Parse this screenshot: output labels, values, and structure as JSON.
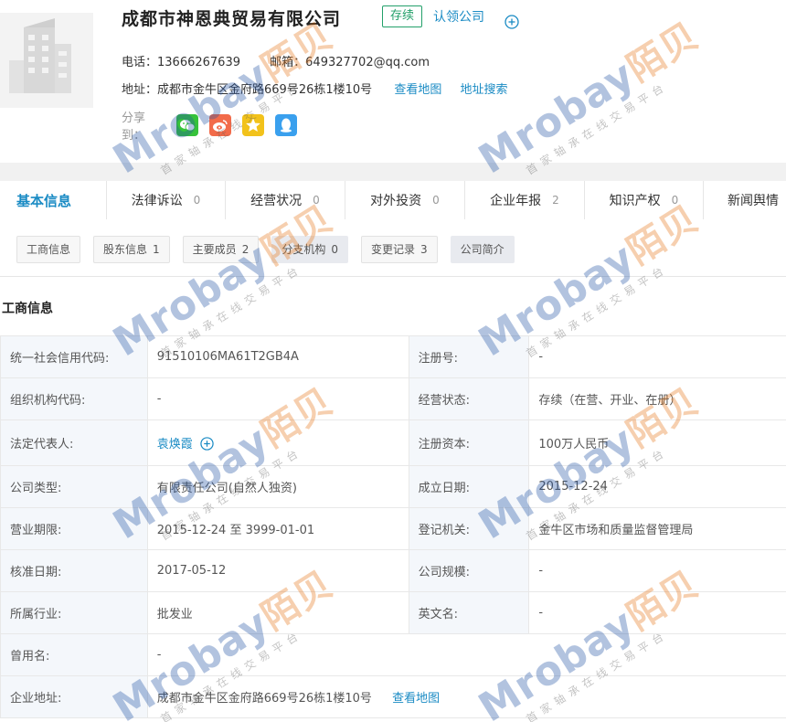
{
  "company": {
    "name": "成都市神恩典贸易有限公司",
    "status": "存续",
    "claim_label": "认领公司",
    "phone_label": "电话：",
    "phone": "13666267639",
    "email_label": "邮箱：",
    "email": "649327702@qq.com",
    "address_label": "地址：",
    "address": "成都市金牛区金府路669号26栋1楼10号",
    "view_map": "查看地图",
    "address_search": "地址搜索",
    "share_label": "分享到："
  },
  "colors": {
    "link": "#1a8bc4",
    "status": "#23a06a"
  },
  "share_icons": [
    "wechat-icon",
    "weibo-icon",
    "star-icon",
    "qq-icon"
  ],
  "main_tabs": [
    {
      "label": "基本信息",
      "count": ""
    },
    {
      "label": "法律诉讼",
      "count": "0"
    },
    {
      "label": "经营状况",
      "count": "0"
    },
    {
      "label": "对外投资",
      "count": "0"
    },
    {
      "label": "企业年报",
      "count": "2"
    },
    {
      "label": "知识产权",
      "count": "0"
    },
    {
      "label": "新闻舆情",
      "count": ""
    }
  ],
  "sub_tabs": [
    {
      "label": "工商信息",
      "count": ""
    },
    {
      "label": "股东信息",
      "count": "1"
    },
    {
      "label": "主要成员",
      "count": "2"
    },
    {
      "label": "分支机构",
      "count": "0"
    },
    {
      "label": "变更记录",
      "count": "3"
    },
    {
      "label": "公司简介",
      "count": ""
    }
  ],
  "section_title": "工商信息",
  "rows": [
    {
      "k1": "统一社会信用代码:",
      "v1": "91510106MA61T2GB4A",
      "k2": "注册号:",
      "v2": "-"
    },
    {
      "k1": "组织机构代码:",
      "v1": "-",
      "k2": "经营状态:",
      "v2": "存续（在营、开业、在册）"
    },
    {
      "k1": "法定代表人:",
      "v1": "袁焕霞",
      "k2": "注册资本:",
      "v2": "100万人民币"
    },
    {
      "k1": "公司类型:",
      "v1": "有限责任公司(自然人独资)",
      "k2": "成立日期:",
      "v2": "2015-12-24"
    },
    {
      "k1": "营业期限:",
      "v1": "2015-12-24 至 3999-01-01",
      "k2": "登记机关:",
      "v2": "金牛区市场和质量监督管理局"
    },
    {
      "k1": "核准日期:",
      "v1": "2017-05-12",
      "k2": "公司规模:",
      "v2": "-"
    },
    {
      "k1": "所属行业:",
      "v1": "批发业",
      "k2": "英文名:",
      "v2": "-"
    },
    {
      "k1": "曾用名:",
      "v1": "-"
    },
    {
      "k1": "企业地址:",
      "v1": "成都市金牛区金府路669号26栋1楼10号",
      "link": "查看地图"
    }
  ],
  "watermark": {
    "brand": "Mrobay",
    "brand_cn": "陌贝",
    "tagline": "首家轴承在线交易平台"
  }
}
